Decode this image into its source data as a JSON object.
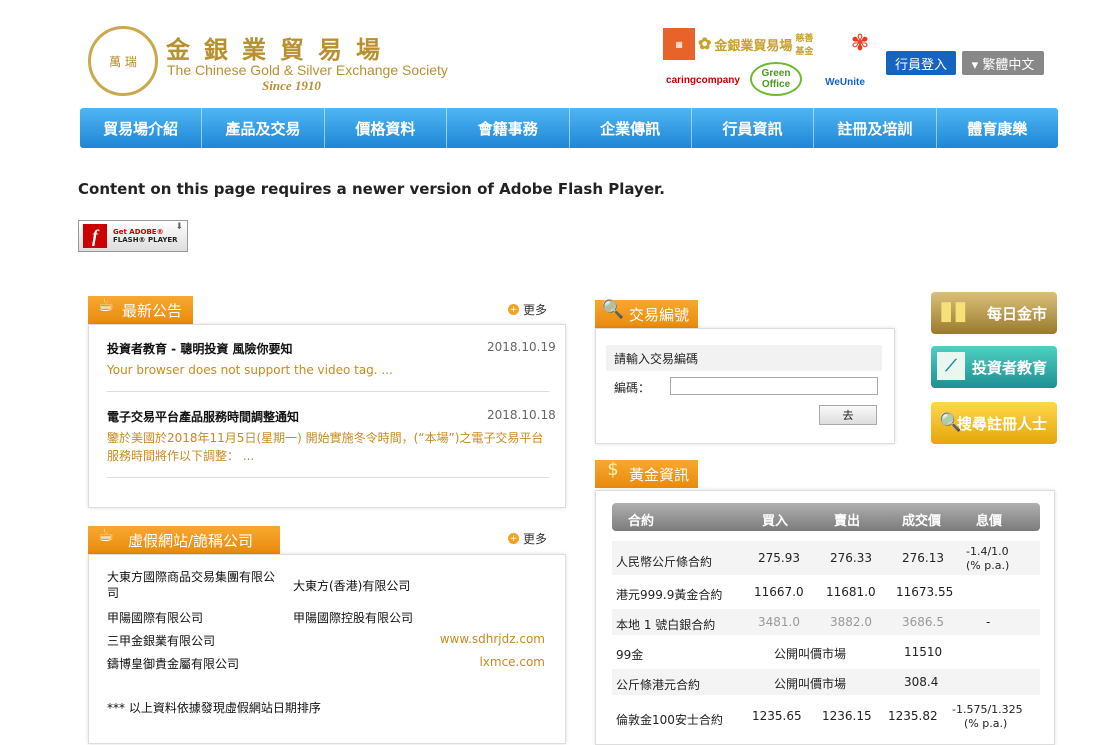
{
  "header": {
    "logo_seal_text": "萬 瑞",
    "logo_zh": "金銀業貿易場",
    "logo_en": "The Chinese Gold & Silver Exchange Society",
    "logo_since": "Since 1910",
    "partner_1": "金銀業貿易場",
    "partner_1_sub": "慈善基金",
    "partner_2": "caringcompany",
    "partner_3": "Green Office",
    "partner_4": "WeUnite",
    "btn_member": "行員登入",
    "btn_lang": "▾ 繁體中文"
  },
  "nav": [
    "貿易場介紹",
    "產品及交易",
    "價格資料",
    "會籍事務",
    "企業傳訊",
    "行員資訊",
    "註冊及培訓",
    "體育康樂"
  ],
  "flash": {
    "message": "Content on this page requires a newer version of Adobe Flash Player.",
    "btn_line1": "Get ADOBE®",
    "btn_line2": "FLASH® PLAYER"
  },
  "announcements": {
    "tab": "最新公告",
    "more": "更多",
    "items": [
      {
        "title": "投資者教育 - 聰明投資 風險你要知",
        "date": "2018.10.19",
        "body": "Your browser does not support the video tag. ..."
      },
      {
        "title": "電子交易平台產品服務時間調整通知",
        "date": "2018.10.18",
        "body": "鑒於美國於2018年11月5日(星期一) 開始實施冬令時間，(“本場”)之電子交易平台服務時間將作以下調整： ..."
      }
    ]
  },
  "fake": {
    "tab": "虛假網站/詭稱公司",
    "more": "更多",
    "rows": [
      {
        "a": "大東方國際商品交易集團有限公司",
        "b": "大東方(香港)有限公司"
      },
      {
        "a": "甲陽國際有限公司",
        "b": "甲陽國際控股有限公司"
      },
      {
        "a": "三甲金銀業有限公司",
        "b": "www.sdhrjdz.com"
      },
      {
        "a": "鑄博皇御貴金屬有限公司",
        "b": "lxmce.com"
      }
    ],
    "note": "*** 以上資料依據發現虛假網站日期排序"
  },
  "trade_code": {
    "tab": "交易編號",
    "prompt": "請輸入交易編碼",
    "label": "編碼：",
    "submit": "去"
  },
  "gold": {
    "tab": "黃金資訊",
    "headers": [
      "合約",
      "買入",
      "賣出",
      "成交價",
      "息價"
    ],
    "rows": [
      {
        "name": "人民幣公斤條合約",
        "buy": "275.93",
        "sell": "276.33",
        "deal": "276.13",
        "rate": "-1.4/1.0",
        "rate2": "(% p.a.)"
      },
      {
        "name": "港元999.9黃金合約",
        "buy": "11667.0",
        "sell": "11681.0",
        "deal": "11673.55",
        "rate": "",
        "rate2": ""
      },
      {
        "name": "本地 1 號白銀合約",
        "buy": "3481.0",
        "sell": "3882.0",
        "deal": "3686.5",
        "rate": "-",
        "rate2": ""
      },
      {
        "name": "99金",
        "buy": "公開叫價市場",
        "sell": "",
        "deal": "11510",
        "rate": "",
        "rate2": ""
      },
      {
        "name": "公斤條港元合約",
        "buy": "公開叫價市場",
        "sell": "",
        "deal": "308.4",
        "rate": "",
        "rate2": ""
      },
      {
        "name": "倫敦金100安士合約",
        "buy": "1235.65",
        "sell": "1236.15",
        "deal": "1235.82",
        "rate": "-1.575/1.325",
        "rate2": "(% p.a.)"
      }
    ]
  },
  "side": {
    "btn1": "每日金市",
    "btn2": "投資者教育",
    "btn3": "搜尋註冊人士"
  },
  "colors": {
    "nav": "#1e86d6",
    "accent_orange": "#e98a0c",
    "gold_text": "#b9902f",
    "link_orange": "#c98a20"
  }
}
